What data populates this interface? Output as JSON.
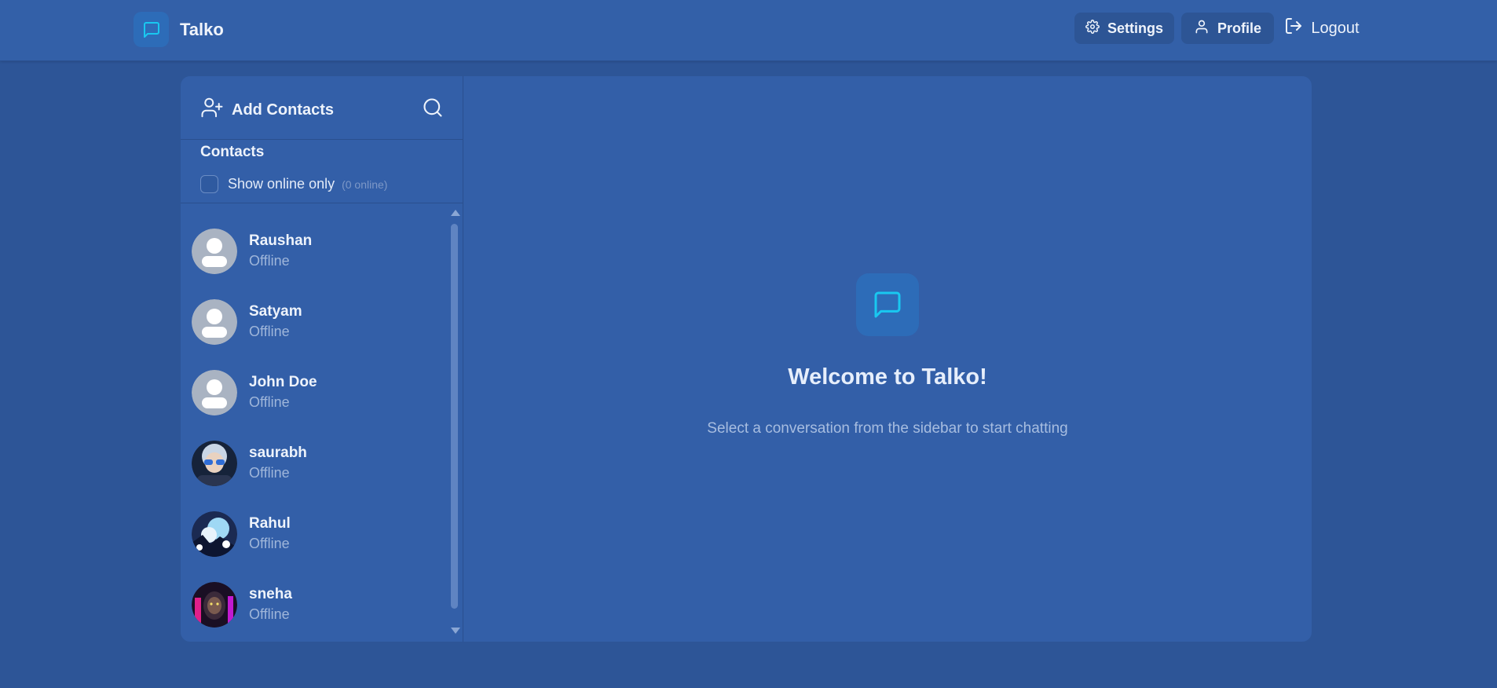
{
  "header": {
    "app_name": "Talko",
    "nav": {
      "settings_label": "Settings",
      "profile_label": "Profile",
      "logout_label": "Logout"
    }
  },
  "sidebar": {
    "add_contacts_label": "Add Contacts",
    "contacts_title": "Contacts",
    "online_filter_label": "Show online only",
    "online_count": "(0 online)",
    "contacts": [
      {
        "name": "Raushan",
        "status": "Offline",
        "avatar": "default"
      },
      {
        "name": "Satyam",
        "status": "Offline",
        "avatar": "default"
      },
      {
        "name": "John Doe",
        "status": "Offline",
        "avatar": "default"
      },
      {
        "name": "saurabh",
        "status": "Offline",
        "avatar": "photo"
      },
      {
        "name": "Rahul",
        "status": "Offline",
        "avatar": "photo"
      },
      {
        "name": "sneha",
        "status": "Offline",
        "avatar": "photo"
      }
    ]
  },
  "main": {
    "welcome_title": "Welcome to Talko!",
    "welcome_subtitle": "Select a conversation from the sidebar to start chatting"
  },
  "icons": {
    "logo": "message-square-icon",
    "settings": "gear-icon",
    "profile": "user-icon",
    "logout": "logout-icon",
    "add_contacts": "user-plus-icon",
    "search": "search-icon"
  },
  "colors": {
    "background": "#2d5597",
    "surface": "#335fa8",
    "accent": "#19c8f0",
    "logo_tile": "#2d6cb8"
  }
}
